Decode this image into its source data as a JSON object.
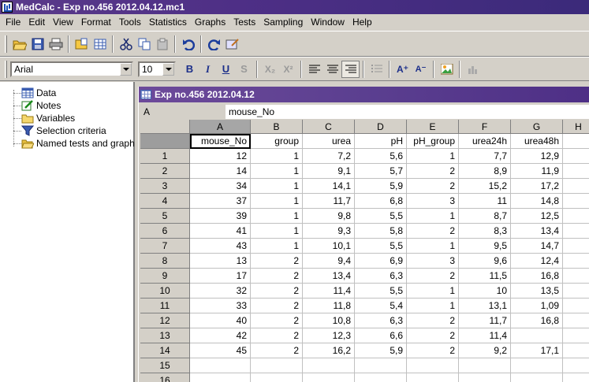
{
  "window": {
    "title": "MedCalc - Exp no.456 2012.04.12.mc1"
  },
  "menu": [
    {
      "label": "File",
      "name": "menu-file"
    },
    {
      "label": "Edit",
      "name": "menu-edit"
    },
    {
      "label": "View",
      "name": "menu-view"
    },
    {
      "label": "Format",
      "name": "menu-format"
    },
    {
      "label": "Tools",
      "name": "menu-tools"
    },
    {
      "label": "Statistics",
      "name": "menu-statistics"
    },
    {
      "label": "Graphs",
      "name": "menu-graphs"
    },
    {
      "label": "Tests",
      "name": "menu-tests"
    },
    {
      "label": "Sampling",
      "name": "menu-sampling"
    },
    {
      "label": "Window",
      "name": "menu-window"
    },
    {
      "label": "Help",
      "name": "menu-help"
    }
  ],
  "format_toolbar": {
    "font": "Arial",
    "size": "10",
    "bold": "B",
    "italic": "I",
    "underline": "U",
    "strike": "S",
    "subscript": "X₂",
    "superscript": "X²",
    "increase_font": "A⁺",
    "decrease_font": "A⁻"
  },
  "tree": [
    {
      "label": "Data",
      "icon": "spreadsheet-icon"
    },
    {
      "label": "Notes",
      "icon": "notes-icon"
    },
    {
      "label": "Variables",
      "icon": "folder-icon"
    },
    {
      "label": "Selection criteria",
      "icon": "filter-icon"
    },
    {
      "label": "Named tests and graphs",
      "icon": "folder-open-icon"
    }
  ],
  "spreadsheet": {
    "title": "Exp no.456 2012.04.12",
    "cell_ref": "A",
    "cell_content": "mouse_No",
    "column_letters": [
      "A",
      "B",
      "C",
      "D",
      "E",
      "F",
      "G",
      "H"
    ],
    "headers": [
      "mouse_No",
      "group",
      "urea",
      "pH",
      "pH_group",
      "urea24h",
      "urea48h"
    ],
    "rows": [
      {
        "num": "1",
        "cells": [
          "12",
          "1",
          "7,2",
          "5,6",
          "1",
          "7,7",
          "12,9"
        ]
      },
      {
        "num": "2",
        "cells": [
          "14",
          "1",
          "9,1",
          "5,7",
          "2",
          "8,9",
          "11,9"
        ]
      },
      {
        "num": "3",
        "cells": [
          "34",
          "1",
          "14,1",
          "5,9",
          "2",
          "15,2",
          "17,2"
        ]
      },
      {
        "num": "4",
        "cells": [
          "37",
          "1",
          "11,7",
          "6,8",
          "3",
          "11",
          "14,8"
        ]
      },
      {
        "num": "5",
        "cells": [
          "39",
          "1",
          "9,8",
          "5,5",
          "1",
          "8,7",
          "12,5"
        ]
      },
      {
        "num": "6",
        "cells": [
          "41",
          "1",
          "9,3",
          "5,8",
          "2",
          "8,3",
          "13,4"
        ]
      },
      {
        "num": "7",
        "cells": [
          "43",
          "1",
          "10,1",
          "5,5",
          "1",
          "9,5",
          "14,7"
        ]
      },
      {
        "num": "8",
        "cells": [
          "13",
          "2",
          "9,4",
          "6,9",
          "3",
          "9,6",
          "12,4"
        ]
      },
      {
        "num": "9",
        "cells": [
          "17",
          "2",
          "13,4",
          "6,3",
          "2",
          "11,5",
          "16,8"
        ]
      },
      {
        "num": "10",
        "cells": [
          "32",
          "2",
          "11,4",
          "5,5",
          "1",
          "10",
          "13,5"
        ]
      },
      {
        "num": "11",
        "cells": [
          "33",
          "2",
          "11,8",
          "5,4",
          "1",
          "13,1",
          "1,09"
        ]
      },
      {
        "num": "12",
        "cells": [
          "40",
          "2",
          "10,8",
          "6,3",
          "2",
          "11,7",
          "16,8"
        ]
      },
      {
        "num": "13",
        "cells": [
          "42",
          "2",
          "12,3",
          "6,6",
          "2",
          "11,4",
          ""
        ]
      },
      {
        "num": "14",
        "cells": [
          "45",
          "2",
          "16,2",
          "5,9",
          "2",
          "9,2",
          "17,1"
        ]
      },
      {
        "num": "15",
        "cells": [
          "",
          "",
          "",
          "",
          "",
          "",
          ""
        ]
      },
      {
        "num": "16",
        "cells": [
          "",
          "",
          "",
          "",
          "",
          "",
          ""
        ]
      }
    ]
  }
}
